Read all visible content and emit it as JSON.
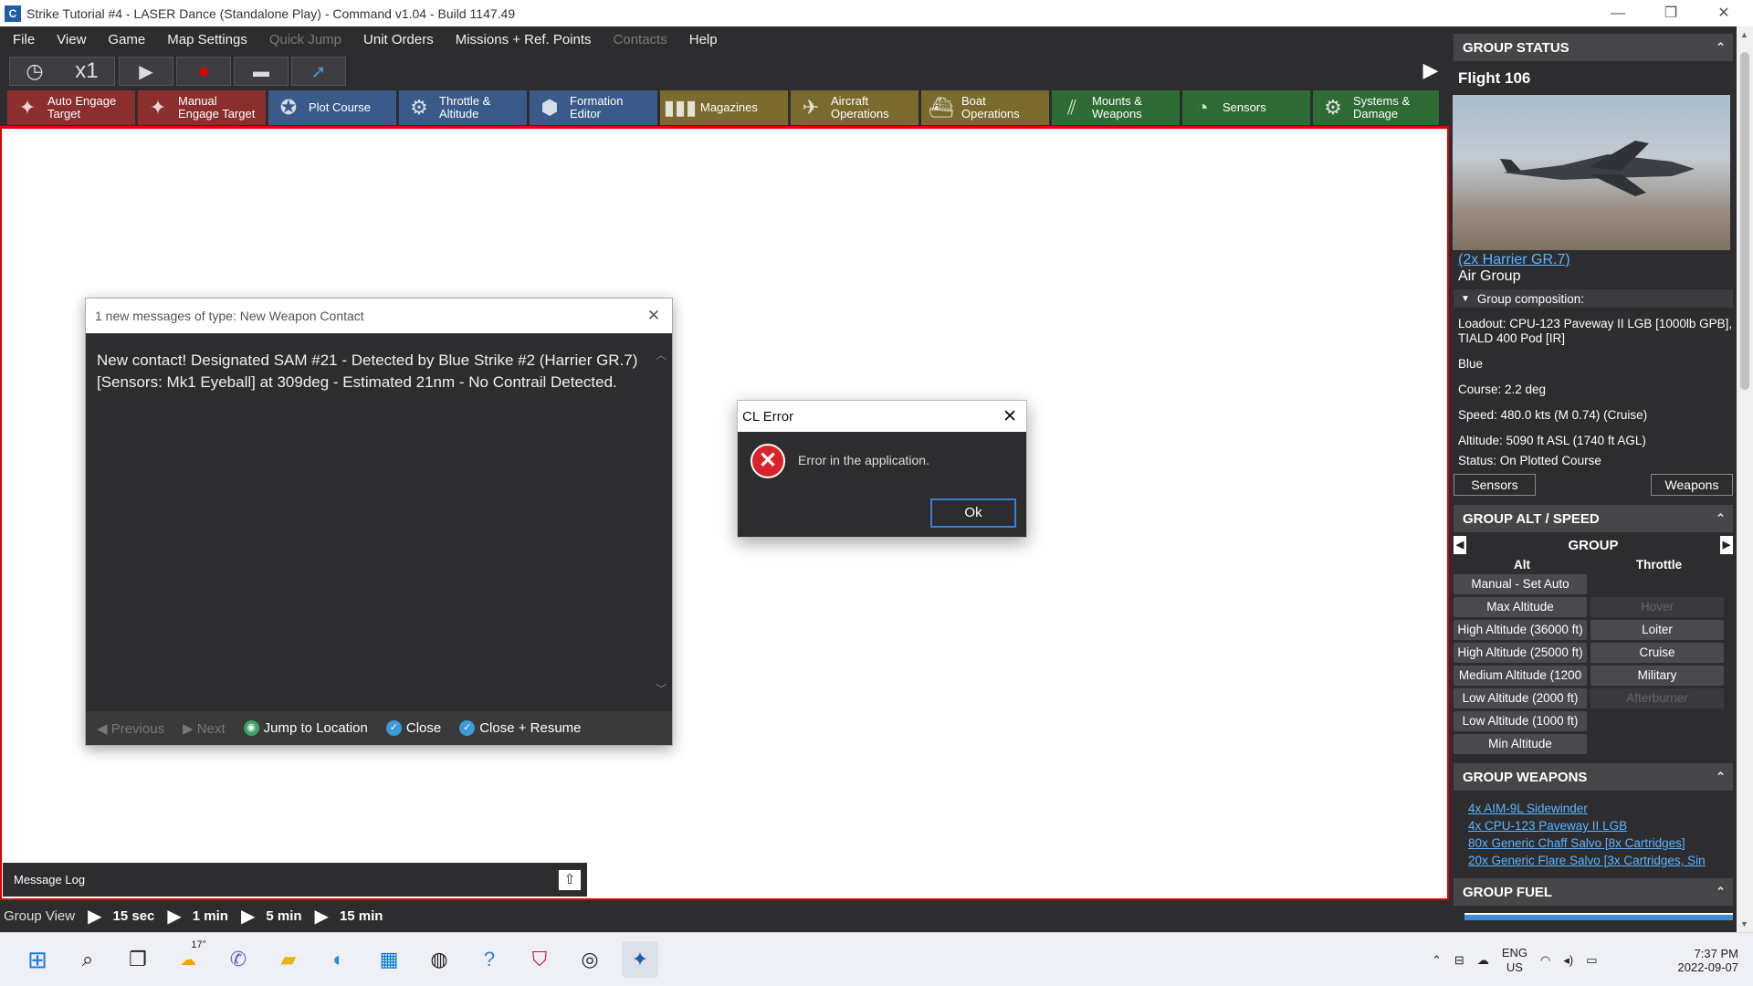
{
  "window": {
    "title": "Strike Tutorial #4 - LASER Dance (Standalone Play) - Command v1.04 - Build 1147.49",
    "minimize": "—",
    "restore": "❐",
    "close": "✕"
  },
  "menu": [
    {
      "label": "File",
      "enabled": true
    },
    {
      "label": "View",
      "enabled": true
    },
    {
      "label": "Game",
      "enabled": true
    },
    {
      "label": "Map Settings",
      "enabled": true
    },
    {
      "label": "Quick Jump",
      "enabled": false
    },
    {
      "label": "Unit Orders",
      "enabled": true
    },
    {
      "label": "Missions + Ref. Points",
      "enabled": true
    },
    {
      "label": "Contacts",
      "enabled": false
    },
    {
      "label": "Help",
      "enabled": true
    }
  ],
  "controls": {
    "time_compression": "x1"
  },
  "toolbar": [
    {
      "label1": "Auto Engage",
      "label2": "Target",
      "color": "red",
      "icon": "crosshair-icon"
    },
    {
      "label1": "Manual",
      "label2": "Engage Target",
      "color": "red",
      "icon": "crosshair-icon"
    },
    {
      "label1": "Plot Course",
      "label2": "",
      "color": "blue",
      "icon": "compass-icon"
    },
    {
      "label1": "Throttle &",
      "label2": "Altitude",
      "color": "blue",
      "icon": "gear-icon"
    },
    {
      "label1": "Formation",
      "label2": "Editor",
      "color": "blue",
      "icon": "formation-icon"
    },
    {
      "label1": "Magazines",
      "label2": "",
      "color": "gold",
      "icon": "ammo-icon"
    },
    {
      "label1": "Aircraft",
      "label2": "Operations",
      "color": "gold",
      "icon": "aircraft-icon"
    },
    {
      "label1": "Boat",
      "label2": "Operations",
      "color": "gold",
      "icon": "boat-icon"
    },
    {
      "label1": "Mounts &",
      "label2": "Weapons",
      "color": "green",
      "icon": "weapons-icon"
    },
    {
      "label1": "Sensors",
      "label2": "",
      "color": "green",
      "icon": "radar-icon"
    },
    {
      "label1": "Systems &",
      "label2": "Damage",
      "color": "green",
      "icon": "gear-icon"
    }
  ],
  "message_window": {
    "title": "1 new messages of type: New Weapon Contact",
    "body": "New contact! Designated SAM #21 - Detected by Blue Strike #2 (Harrier GR.7) [Sensors: Mk1 Eyeball] at 309deg - Estimated 21nm - No Contrail Detected.",
    "previous": "Previous",
    "next": "Next",
    "jump": "Jump to Location",
    "close": "Close",
    "close_resume": "Close + Resume"
  },
  "error_dialog": {
    "title": "CL Error",
    "message": "Error in the application.",
    "ok": "Ok"
  },
  "message_log": {
    "label": "Message Log"
  },
  "statusbar": {
    "group_view": "Group View",
    "steps": [
      "15 sec",
      "1 min",
      "5 min",
      "15 min"
    ]
  },
  "side_panel": {
    "group_status_header": "GROUP STATUS",
    "flight_name": "Flight 106",
    "unit_link": "(2x Harrier GR.7)",
    "unit_type": "Air Group",
    "composition_label": "Group composition:",
    "loadout": "Loadout: CPU-123 Paveway II LGB [1000lb GPB], TIALD 400 Pod [IR]",
    "side": "Blue",
    "course": "Course: 2.2 deg",
    "speed": "Speed: 480.0 kts (M 0.74) (Cruise)",
    "altitude": "Altitude: 5090 ft ASL (1740 ft AGL)",
    "status": "Status: On Plotted Course",
    "sensors_btn": "Sensors",
    "weapons_btn": "Weapons",
    "alt_speed_header": "GROUP ALT / SPEED",
    "group_label": "GROUP",
    "alt_col": "Alt",
    "throttle_col": "Throttle",
    "alt_buttons": [
      "Manual - Set Auto",
      "Max Altitude",
      "High Altitude (36000 ft)",
      "High Altitude (25000 ft)",
      "Medium Altitude (1200",
      "Low Altitude (2000 ft)",
      "Low Altitude (1000 ft)",
      "Min Altitude"
    ],
    "throttle_buttons": [
      "",
      "Hover",
      "Loiter",
      "Cruise",
      "Military",
      "Afterburner",
      "",
      ""
    ],
    "throttle_enabled": [
      false,
      false,
      true,
      true,
      true,
      false,
      false,
      false
    ],
    "weapons_header": "GROUP WEAPONS",
    "weapons": [
      "4x AIM-9L Sidewinder",
      "4x CPU-123 Paveway II LGB",
      "80x Generic Chaff Salvo [8x Cartridges]",
      "20x Generic Flare Salvo [3x Cartridges, Sin"
    ],
    "fuel_header": "GROUP FUEL",
    "collapse_icon": "⌃"
  },
  "taskbar": {
    "weather_temp": "17°",
    "lang1": "ENG",
    "lang2": "US",
    "time": "7:37 PM",
    "date": "2022-09-07"
  },
  "colors": {
    "toolbar_red": "#8b2e2e",
    "toolbar_blue": "#3a5a8a",
    "toolbar_gold": "#7a6a2e",
    "toolbar_green": "#2e6b35",
    "map_border": "#e00000",
    "link": "#5cb3ff"
  }
}
